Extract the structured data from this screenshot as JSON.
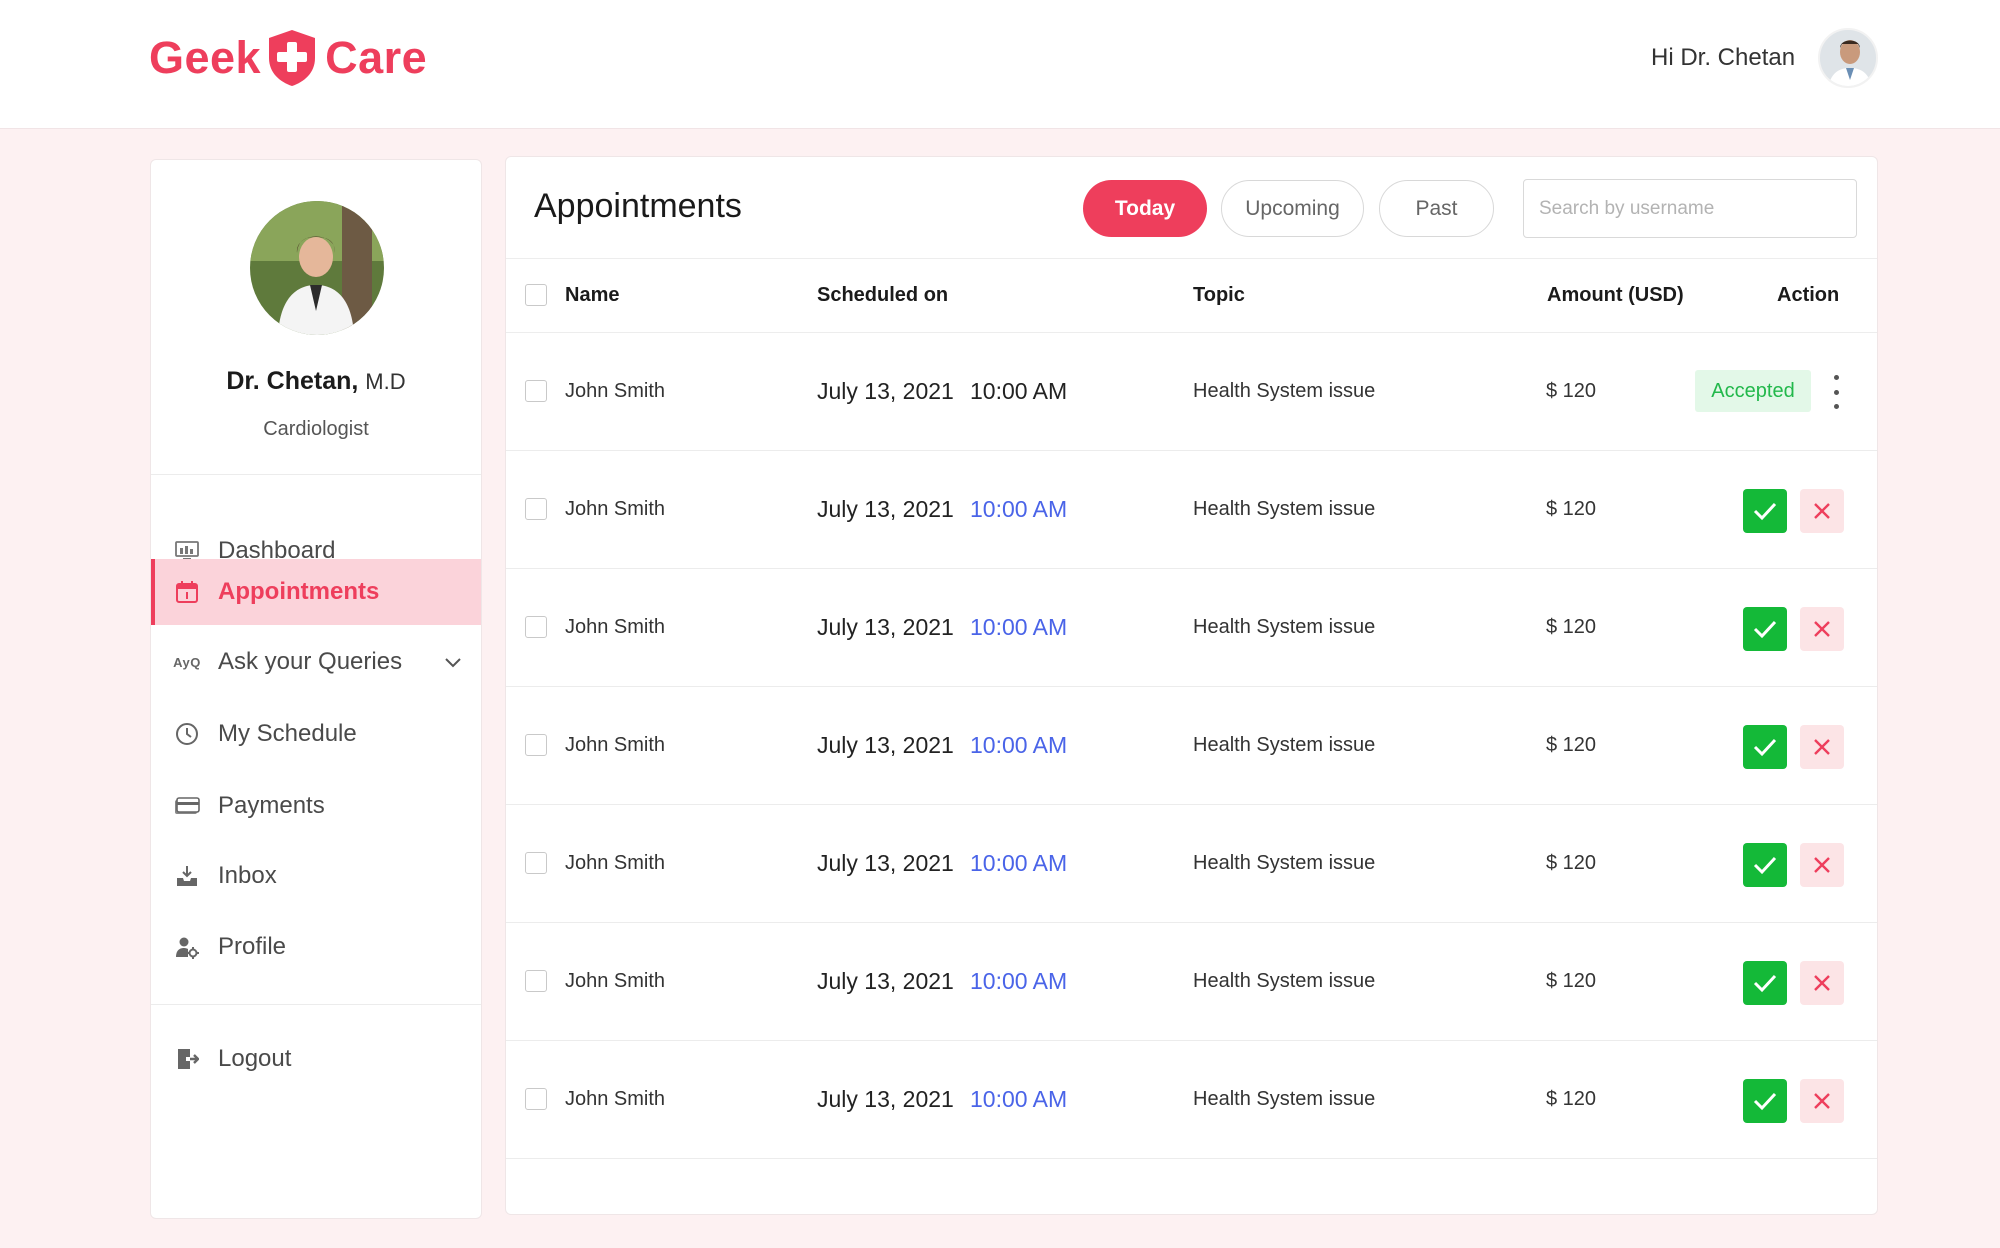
{
  "header": {
    "logo_left": "Geek",
    "logo_right": "Care",
    "greeting": "Hi Dr. Chetan"
  },
  "sidebar": {
    "doctor_name": "Dr. Chetan,",
    "doctor_suffix": "M.D",
    "specialty": "Cardiologist",
    "items": [
      {
        "label": "Dashboard",
        "icon": "dashboard-icon"
      },
      {
        "label": "Appointments",
        "icon": "calendar-icon"
      },
      {
        "label": "Ask your Queries",
        "icon": "ayq-icon",
        "icon_text": "AyQ"
      },
      {
        "label": "My Schedule",
        "icon": "clock-icon"
      },
      {
        "label": "Payments",
        "icon": "card-icon"
      },
      {
        "label": "Inbox",
        "icon": "inbox-icon"
      },
      {
        "label": "Profile",
        "icon": "profile-icon"
      }
    ],
    "logout_label": "Logout"
  },
  "main": {
    "title": "Appointments",
    "filters": {
      "today": "Today",
      "upcoming": "Upcoming",
      "past": "Past"
    },
    "search_placeholder": "Search by username",
    "columns": {
      "name": "Name",
      "scheduled": "Scheduled on",
      "topic": "Topic",
      "amount": "Amount (USD)",
      "action": "Action"
    },
    "rows": [
      {
        "name": "John Smith",
        "date": "July 13, 2021",
        "time": "10:00 AM",
        "topic": "Health System issue",
        "amount": "$ 120",
        "status": "Accepted"
      },
      {
        "name": "John Smith",
        "date": "July 13, 2021",
        "time": "10:00 AM",
        "topic": "Health System issue",
        "amount": "$ 120",
        "status": ""
      },
      {
        "name": "John Smith",
        "date": "July 13, 2021",
        "time": "10:00 AM",
        "topic": "Health System issue",
        "amount": "$ 120",
        "status": ""
      },
      {
        "name": "John Smith",
        "date": "July 13, 2021",
        "time": "10:00 AM",
        "topic": "Health System issue",
        "amount": "$ 120",
        "status": ""
      },
      {
        "name": "John Smith",
        "date": "July 13, 2021",
        "time": "10:00 AM",
        "topic": "Health System issue",
        "amount": "$ 120",
        "status": ""
      },
      {
        "name": "John Smith",
        "date": "July 13, 2021",
        "time": "10:00 AM",
        "topic": "Health System issue",
        "amount": "$ 120",
        "status": ""
      },
      {
        "name": "John Smith",
        "date": "July 13, 2021",
        "time": "10:00 AM",
        "topic": "Health System issue",
        "amount": "$ 120",
        "status": ""
      }
    ]
  },
  "colors": {
    "brand": "#ee3e5c",
    "accept": "#14b938",
    "time_link": "#4a64e8",
    "accepted_badge_bg": "#e3f8e8"
  }
}
